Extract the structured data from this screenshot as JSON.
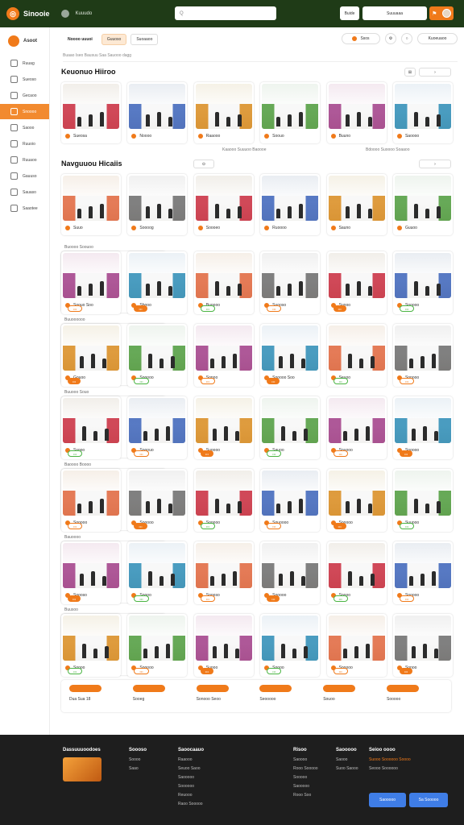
{
  "header": {
    "brand": "Sinooie",
    "nav_link": "Kuuudo",
    "search_placeholder": "Q",
    "btn_a": "Buide",
    "btn_b": "Suuuaaa"
  },
  "sidebar": {
    "title": "Asoot",
    "items": [
      {
        "label": "Ruuag",
        "icon": "home-icon"
      },
      {
        "label": "Sueoso",
        "icon": "store-icon"
      },
      {
        "label": "Gecaoo",
        "icon": "grid-icon"
      },
      {
        "label": "Snoooo",
        "icon": "tag-icon",
        "active": true
      },
      {
        "label": "Saooo",
        "icon": "user-icon"
      },
      {
        "label": "Ruuoio",
        "icon": "chart-icon"
      },
      {
        "label": "Ruuaoo",
        "icon": "calendar-icon"
      },
      {
        "label": "Gauuso",
        "icon": "clock-icon"
      },
      {
        "label": "Sauaso",
        "icon": "list-icon"
      },
      {
        "label": "Saaotee",
        "icon": "settings-icon"
      }
    ]
  },
  "toolbar": {
    "tabs": [
      "Noooo uuuoi",
      "Guuoso",
      "Suoaaoo"
    ],
    "tools": [
      "Ssos",
      "Kuoeuaoo"
    ],
    "subline": "Buaao Iseo Bausuu Saa Sauooo dagg"
  },
  "section1": {
    "title": "Keuonuo Hiiroo",
    "sub": "Kaaooo Suuuoo Baoooe",
    "sub2": "Bdoooo Suoooo Soaaoo",
    "cards": [
      "Sueosa",
      "Noooo",
      "Raaooo",
      "Soouo",
      "Buuno",
      "Saoooo"
    ]
  },
  "section2": {
    "title": "Navguuou Hicaiis",
    "cards": [
      "Suuo",
      "Soooog",
      "Soooeo",
      "Ruoooo",
      "Sauno",
      "Guuoo"
    ]
  },
  "groups": [
    {
      "label": "Buoooo Soouoo",
      "cards": [
        "Soouo Soo",
        "Sbooo",
        "Buoooo",
        "Suooso",
        "Suooo",
        "Sooooo"
      ]
    },
    {
      "label": "Buuoooooo",
      "cards": [
        "Gouoo",
        "Sooooo",
        "Sonoo",
        "Sooooo Soo",
        "Seuoo",
        "Sonooo"
      ]
    },
    {
      "label": "Buuooo Souo",
      "cards": [
        "Ssooo",
        "Sooouo",
        "Suoooo",
        "Sauoo",
        "Souooo",
        "Sooooo"
      ]
    },
    {
      "label": "Baoooo Boooo",
      "cards": [
        "Sooooo",
        "Sooooo",
        "Sooooo",
        "Souoooo",
        "Sooooo",
        "Suuooo"
      ]
    },
    {
      "label": "Bauoooo",
      "cards": [
        "Soooso",
        "Soooo",
        "Soooso",
        "Sooooo",
        "Soooo",
        "Sooooo"
      ]
    },
    {
      "label": "Buusoo",
      "cards": [
        "Soooo",
        "Sooooo",
        "Suooo",
        "Soooo",
        "Sooooo",
        "Sonoo"
      ]
    }
  ],
  "bottom_items": [
    "Dua Sua 18",
    "Sooeg",
    "Sonooo Seoo",
    "Seooooo",
    "Souoo",
    "Sooooo"
  ],
  "footer": {
    "col1_title": "Dassuuuoodoes",
    "col2_title": "Soooso",
    "col2_links": [
      "Soooo",
      "Saao"
    ],
    "col3_title": "Saoocaauo",
    "col3_links": [
      "Raaooo",
      "Seuoo Saoo",
      "Saooooo",
      "Soooooo",
      "Reuooo",
      "Raoo Sooooo"
    ],
    "col4_title": "Risoo",
    "col4_links": [
      "Saoooo",
      "Rooo Sooooo",
      "Sooooo",
      "Saooooo",
      "Rooo Soo"
    ],
    "col5_title": "Saooooo",
    "col5_links": [
      "Saooo",
      "Suoo Saooo"
    ],
    "col6_title": "Seioo oooo",
    "col6_links": [
      "Suooo Soooooo Soooo",
      "Seooo Soooooo"
    ],
    "btn_primary": "Saooooo",
    "btn_secondary": "Sa Sooooo"
  },
  "colors": {
    "accent": "#f07a1a",
    "header_bg": "#1f3b17",
    "footer_bg": "#1e1e1e",
    "blue": "#3f7de6"
  }
}
